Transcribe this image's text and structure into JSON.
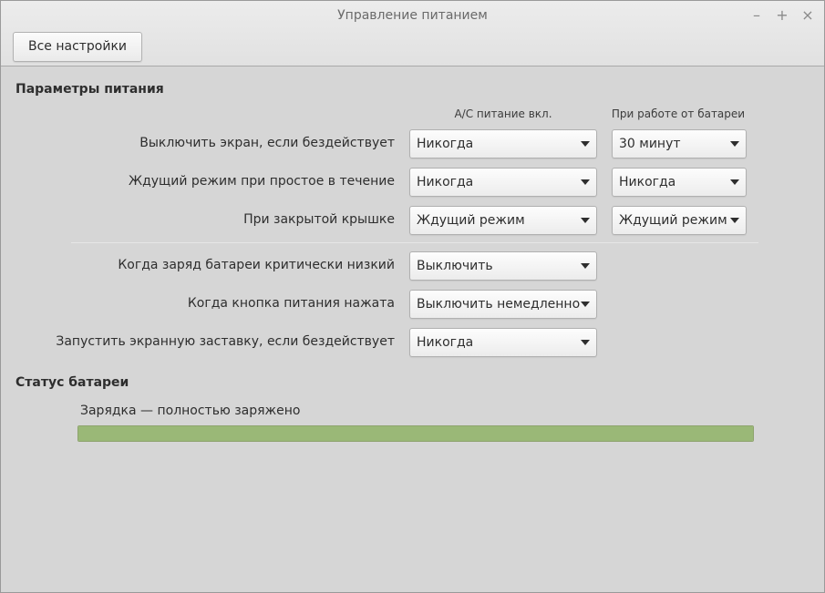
{
  "window": {
    "title": "Управление питанием",
    "controls": {
      "minimize": "–",
      "maximize": "+",
      "close": "×"
    }
  },
  "toolbar": {
    "all_settings_label": "Все настройки"
  },
  "power": {
    "section_title": "Параметры питания",
    "col_ac": "A/C питание вкл.",
    "col_battery": "При работе от батареи",
    "rows": [
      {
        "label": "Выключить экран, если бездействует",
        "ac": "Никогда",
        "battery": "30 минут"
      },
      {
        "label": "Ждущий режим при простое в течение",
        "ac": "Никогда",
        "battery": "Никогда"
      },
      {
        "label": "При закрытой крышке",
        "ac": "Ждущий режим",
        "battery": "Ждущий режим"
      }
    ],
    "single_rows": [
      {
        "label": "Когда заряд батареи критически низкий",
        "value": "Выключить"
      },
      {
        "label": "Когда кнопка питания нажата",
        "value": "Выключить немедленно"
      },
      {
        "label": "Запустить экранную заставку, если бездействует",
        "value": "Никогда"
      }
    ]
  },
  "battery": {
    "section_title": "Статус батареи",
    "status": "Зарядка — полностью заряжено",
    "level": 1.0,
    "bar_color": "#9ab877"
  }
}
